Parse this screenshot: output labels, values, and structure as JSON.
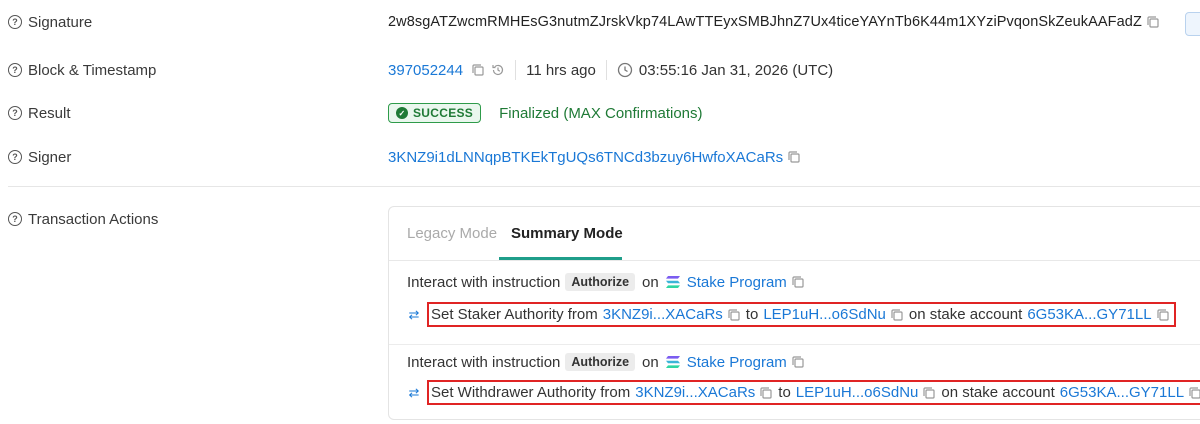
{
  "overview": {
    "signature": {
      "label": "Signature",
      "value": "2w8sgATZwcmRMHEsG3nutmZJrskVkp74LAwTTEyxSMBJhnZ7Ux4ticeYAYnTb6K44m1XYziPvqonSkZeukAAFadZ"
    },
    "block": {
      "label": "Block & Timestamp",
      "slot": "397052244",
      "ago": "11 hrs ago",
      "timestamp": "03:55:16 Jan 31, 2026 (UTC)"
    },
    "result": {
      "label": "Result",
      "status": "SUCCESS",
      "confirmation": "Finalized (MAX Confirmations)",
      "status_color": "#1f7a36"
    },
    "signer": {
      "label": "Signer",
      "address": "3KNZ9i1dLNNqpBTKEkTgUQs6TNCd3bzuy6HwfoXACaRs"
    }
  },
  "transaction_actions": {
    "label": "Transaction Actions",
    "tabs": [
      {
        "label": "Legacy Mode",
        "active": false
      },
      {
        "label": "Summary Mode",
        "active": true
      }
    ],
    "instructions": [
      {
        "prefix": "Interact with instruction",
        "instruction": "Authorize",
        "on": "on",
        "program": "Stake Program",
        "action": {
          "text": "Set Staker Authority from",
          "from": "3KNZ9i...XACaRs",
          "to_word": "to",
          "to": "LEP1uH...o6SdNu",
          "account_text": "on stake account",
          "account": "6G53KA...GY71LL"
        }
      },
      {
        "prefix": "Interact with instruction",
        "instruction": "Authorize",
        "on": "on",
        "program": "Stake Program",
        "action": {
          "text": "Set Withdrawer Authority from",
          "from": "3KNZ9i...XACaRs",
          "to_word": "to",
          "to": "LEP1uH...o6SdNu",
          "account_text": "on stake account",
          "account": "6G53KA...GY71LL"
        }
      }
    ]
  },
  "colors": {
    "link": "#1a78d6",
    "success": "#1f7a36",
    "highlight_border": "#e02424",
    "tab_active_underline": "#1f9e8a"
  }
}
